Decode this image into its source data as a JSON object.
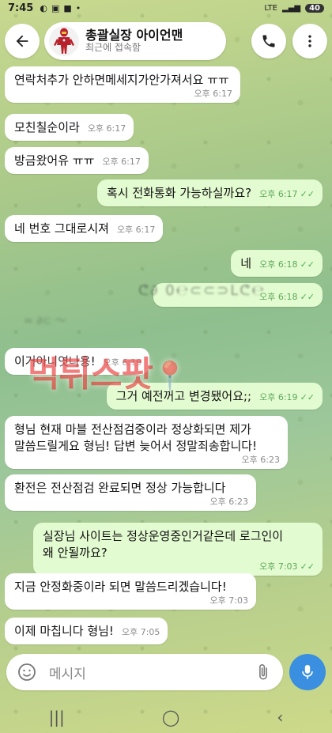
{
  "status_bar": {
    "time": "7:45",
    "network": "LTE",
    "battery": "40"
  },
  "header": {
    "title": "총괄실장 아이언맨",
    "subtitle": "최근에 접속함"
  },
  "messages": [
    {
      "dir": "in",
      "text": "연락처추가 안하면메세지가안가져서요 ㅠㅠ",
      "time": "오후 6:17"
    },
    {
      "dir": "in",
      "text": "모친칠순이라",
      "time": "오후 6:17"
    },
    {
      "dir": "in",
      "text": "방금왔어유 ㅠㅠ",
      "time": "오후 6:17"
    },
    {
      "dir": "out",
      "text": "혹시 전화통화 가능하실까요?",
      "time": "오후 6:17"
    },
    {
      "dir": "in",
      "text": "네 번호 그대로시져",
      "time": "오후 6:17"
    },
    {
      "dir": "out",
      "text": "네",
      "time": "오후 6:18"
    },
    {
      "dir": "out",
      "text": "",
      "time": "오후 6:18"
    },
    {
      "dir": "in",
      "text": "이거아니엿나용!",
      "time": "오후 6:19"
    },
    {
      "dir": "out",
      "text": "그거 예전꺼고 변경됐어요;;",
      "time": "오후 6:19"
    },
    {
      "dir": "in",
      "text": "형님 현재 마블 전산점검중이라 정상화되면 제가 말씀드릴게요 형님! 답변 늦어서 정말죄송합니다!",
      "line1": "형님 현재 마블 전산점검중이라 정상화되면 제가",
      "line2": "말씀드릴게요 형님! 답변 늦어서 정말죄송합니다!",
      "time": "오후 6:23"
    },
    {
      "dir": "in",
      "text": "환전은 전산점검 완료되면 정상 가능합니다",
      "time": "오후 6:23"
    },
    {
      "dir": "out",
      "text": "실장님 사이트는 정상운영중인거같은데 로그인이 왜 안될까요?",
      "line1": "실장님 사이트는 정상운영중인거같은데 로그인이",
      "line2": "왜 안될까요?",
      "time": "오후 7:03"
    },
    {
      "dir": "in",
      "text": "지금 안정화중이라 되면 말씀드리겠습니다!",
      "time": "오후 7:03"
    },
    {
      "dir": "in",
      "text": "이제 마칩니다 형님!",
      "time": "오후 7:05"
    }
  ],
  "watermark": "먹튀스팟",
  "input": {
    "placeholder": "메시지"
  },
  "icons": {
    "back": "back-arrow-icon",
    "call": "phone-icon",
    "menu": "more-vertical-icon",
    "emoji": "emoji-icon",
    "attach": "paperclip-icon",
    "mic": "microphone-icon"
  }
}
